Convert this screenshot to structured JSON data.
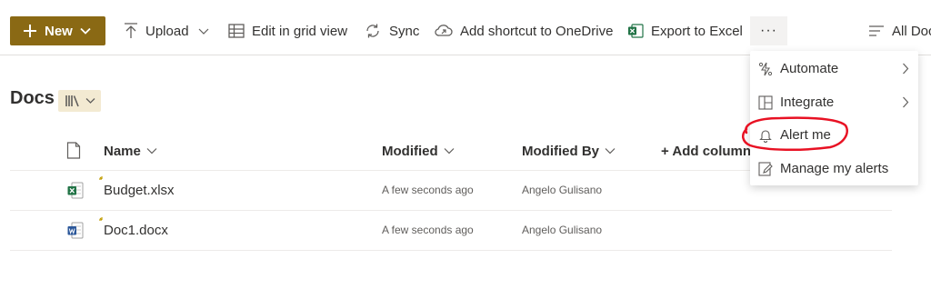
{
  "toolbar": {
    "new_label": "New",
    "upload_label": "Upload",
    "edit_grid_label": "Edit in grid view",
    "sync_label": "Sync",
    "shortcut_label": "Add shortcut to OneDrive",
    "export_label": "Export to Excel",
    "more_label": "···",
    "view_label": "All Doc"
  },
  "library": {
    "title": "Docs"
  },
  "table": {
    "columns": [
      "Name",
      "Modified",
      "Modified By",
      "+ Add column"
    ],
    "rows": [
      {
        "name": "Budget.xlsx",
        "type": "excel",
        "modified": "A few seconds ago",
        "modified_by": "Angelo Gulisano"
      },
      {
        "name": "Doc1.docx",
        "type": "word",
        "modified": "A few seconds ago",
        "modified_by": "Angelo Gulisano"
      }
    ]
  },
  "menu": {
    "items": [
      {
        "label": "Automate",
        "icon": "automate-icon",
        "submenu": true
      },
      {
        "label": "Integrate",
        "icon": "integrate-icon",
        "submenu": true
      },
      {
        "label": "Alert me",
        "icon": "bell-icon",
        "submenu": false
      },
      {
        "label": "Manage my alerts",
        "icon": "manage-alerts-icon",
        "submenu": false
      }
    ]
  },
  "colors": {
    "accent": "#8a6914",
    "annotation": "#e81123",
    "excel": "#217346",
    "word": "#2b579a"
  }
}
